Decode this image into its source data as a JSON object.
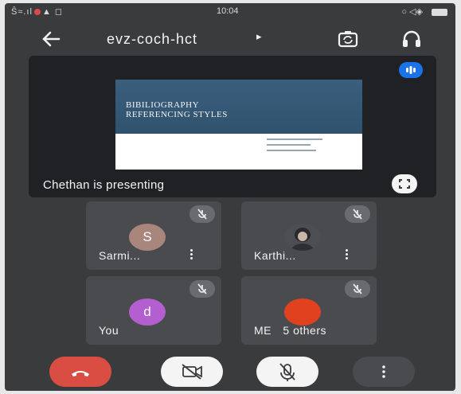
{
  "status_bar": {
    "left": "Ŝ≈.ıl",
    "time": "10:04"
  },
  "header": {
    "meeting_code": "evz-coch-hct",
    "caret": "▸"
  },
  "presentation": {
    "slide_title_line1": "BIBILIOGRAPHY",
    "slide_title_line2": "REFERENCING STYLES",
    "presenter_label": "Chethan is presenting"
  },
  "participants": [
    {
      "name": "Sarmi...",
      "initial": "S",
      "avatar_color": "#a9867c",
      "muted": true
    },
    {
      "name": "Karthi...",
      "initial": "",
      "avatar_color": "#4d4e52",
      "muted": true
    },
    {
      "name": "You",
      "initial": "d",
      "avatar_color": "#b45fcf",
      "muted": true
    },
    {
      "name": "ME",
      "extra": "5 others",
      "initial": "",
      "avatar_color": "#e0421f",
      "muted": true
    }
  ],
  "colors": {
    "background": "#3a3b3d",
    "end_call": "#d94d42",
    "accent_blue": "#1a73e8"
  },
  "icons": [
    "back-arrow-icon",
    "switch-camera-icon",
    "headphones-icon",
    "fullscreen-icon",
    "mic-off-icon",
    "end-call-icon",
    "video-off-icon",
    "more-vert-icon"
  ]
}
